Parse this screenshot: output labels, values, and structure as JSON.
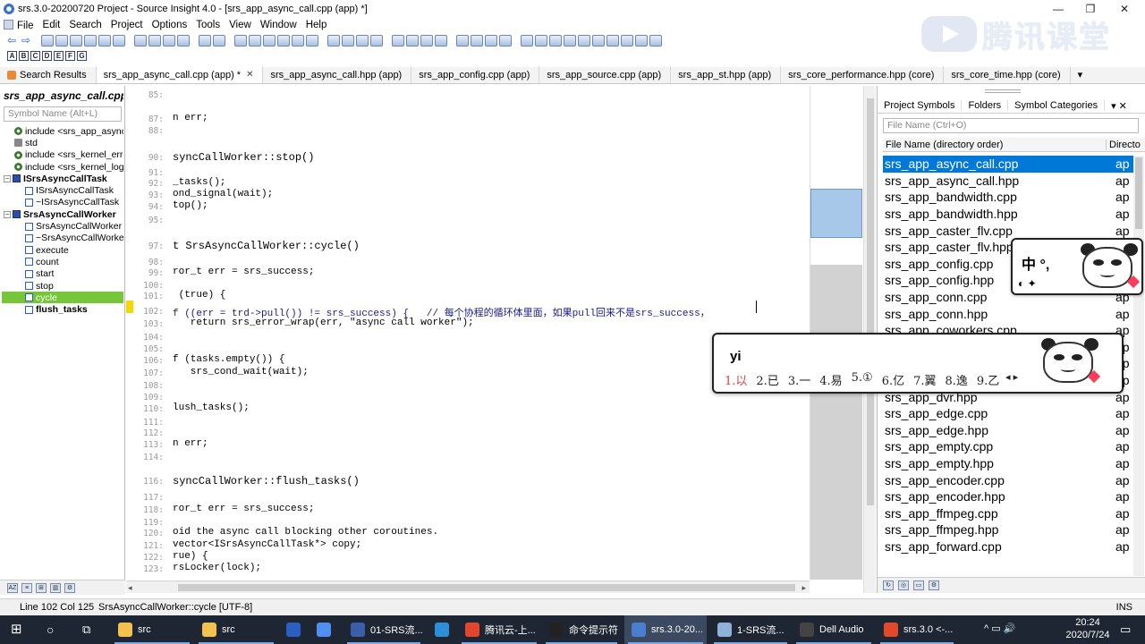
{
  "window": {
    "title": "srs.3.0-20200720 Project - Source Insight 4.0 - [srs_app_async_call.cpp (app) *]",
    "controls": {
      "minimize": "—",
      "restore": "❐",
      "close": "✕"
    }
  },
  "watermark": {
    "text": "腾讯课堂"
  },
  "menu": [
    "File",
    "Edit",
    "Search",
    "Project",
    "Options",
    "Tools",
    "View",
    "Window",
    "Help"
  ],
  "tabs": [
    {
      "label": "Search Results",
      "closable": false
    },
    {
      "label": "srs_app_async_call.cpp (app) *",
      "closable": true
    },
    {
      "label": "srs_app_async_call.hpp (app)",
      "closable": false
    },
    {
      "label": "srs_app_config.cpp (app)",
      "closable": false
    },
    {
      "label": "srs_app_source.cpp (app)",
      "closable": false
    },
    {
      "label": "srs_app_st.hpp (app)",
      "closable": false
    },
    {
      "label": "srs_core_performance.hpp (core)",
      "closable": false
    },
    {
      "label": "srs_core_time.hpp (core)",
      "closable": false
    }
  ],
  "tab_more": "▾",
  "symbol_panel": {
    "title": "srs_app_async_call.cpp",
    "search_placeholder": "Symbol Name (Alt+L)",
    "items": [
      {
        "label": "include <srs_app_async_call.hpp>",
        "kind": "gear",
        "indent": 1
      },
      {
        "label": "std",
        "kind": "ns",
        "indent": 1
      },
      {
        "label": "include <srs_kernel_error.hpp>",
        "kind": "gear",
        "indent": 1
      },
      {
        "label": "include <srs_kernel_log.hpp>",
        "kind": "gear",
        "indent": 1
      },
      {
        "label": "ISrsAsyncCallTask",
        "kind": "cls",
        "indent": 0,
        "bold": true
      },
      {
        "label": "ISrsAsyncCallTask",
        "kind": "fn",
        "indent": 2
      },
      {
        "label": "~ISrsAsyncCallTask",
        "kind": "fn",
        "indent": 2
      },
      {
        "label": "SrsAsyncCallWorker",
        "kind": "cls",
        "indent": 0,
        "bold": true
      },
      {
        "label": "SrsAsyncCallWorker",
        "kind": "fn",
        "indent": 2
      },
      {
        "label": "~SrsAsyncCallWorker",
        "kind": "fn",
        "indent": 2
      },
      {
        "label": "execute",
        "kind": "fn",
        "indent": 2
      },
      {
        "label": "count",
        "kind": "fn",
        "indent": 2
      },
      {
        "label": "start",
        "kind": "fn",
        "indent": 2
      },
      {
        "label": "stop",
        "kind": "fn",
        "indent": 2
      },
      {
        "label": "cycle",
        "kind": "fn",
        "indent": 2,
        "selected": true
      },
      {
        "label": "flush_tasks",
        "kind": "fn",
        "indent": 2,
        "bold": true
      }
    ]
  },
  "editor": {
    "lines": [
      {
        "n": "85:",
        "code": ""
      },
      {
        "n": "87:",
        "code": "n err;"
      },
      {
        "n": "88:",
        "code": ""
      },
      {
        "n": "90:",
        "code": "syncCallWorker::stop()"
      },
      {
        "n": "91:",
        "code": ""
      },
      {
        "n": "92:",
        "code": "_tasks();"
      },
      {
        "n": "93:",
        "code": "ond_signal(wait);"
      },
      {
        "n": "94:",
        "code": "top();"
      },
      {
        "n": "95:",
        "code": ""
      },
      {
        "n": "97:",
        "code": "t SrsAsyncCallWorker::cycle()"
      },
      {
        "n": "98:",
        "code": ""
      },
      {
        "n": "99:",
        "code": "ror_t err = srs_success;"
      },
      {
        "n": "100:",
        "code": ""
      },
      {
        "n": "101:",
        "code": " (true) {"
      },
      {
        "n": "102:",
        "code": "f ((err = trd->pull()) != srs_success) {   // 每个协程的循环体里面，如果pull回来不是srs_success，"
      },
      {
        "n": "103:",
        "code": "   return srs_error_wrap(err, \"async call worker\");"
      },
      {
        "n": "104:",
        "code": ""
      },
      {
        "n": "105:",
        "code": ""
      },
      {
        "n": "106:",
        "code": "f (tasks.empty()) {"
      },
      {
        "n": "107:",
        "code": "   srs_cond_wait(wait);"
      },
      {
        "n": "108:",
        "code": ""
      },
      {
        "n": "109:",
        "code": ""
      },
      {
        "n": "110:",
        "code": "lush_tasks();"
      },
      {
        "n": "111:",
        "code": ""
      },
      {
        "n": "112:",
        "code": ""
      },
      {
        "n": "113:",
        "code": "n err;"
      },
      {
        "n": "114:",
        "code": ""
      },
      {
        "n": "116:",
        "code": "syncCallWorker::flush_tasks()"
      },
      {
        "n": "117:",
        "code": ""
      },
      {
        "n": "118:",
        "code": "ror_t err = srs_success;"
      },
      {
        "n": "119:",
        "code": ""
      },
      {
        "n": "120:",
        "code": "oid the async call blocking other coroutines."
      },
      {
        "n": "121:",
        "code": "vector<ISrsAsyncCallTask*> copy;"
      },
      {
        "n": "122:",
        "code": "rue) {"
      },
      {
        "n": "123:",
        "code": "rsLocker(lock);"
      }
    ]
  },
  "right_panel": {
    "tabs": [
      "Project Symbols",
      "Folders",
      "Symbol Categories"
    ],
    "search_placeholder": "File Name (Ctrl+O)",
    "col_name": "File Name (directory order)",
    "col_dir": "Directo",
    "files": [
      {
        "name": "srs_app_async_call.cpp",
        "dir": "ap",
        "selected": true
      },
      {
        "name": "srs_app_async_call.hpp",
        "dir": "ap"
      },
      {
        "name": "srs_app_bandwidth.cpp",
        "dir": "ap"
      },
      {
        "name": "srs_app_bandwidth.hpp",
        "dir": "ap"
      },
      {
        "name": "srs_app_caster_flv.cpp",
        "dir": "ap"
      },
      {
        "name": "srs_app_caster_flv.hpp",
        "dir": "ap"
      },
      {
        "name": "srs_app_config.cpp",
        "dir": "ap"
      },
      {
        "name": "srs_app_config.hpp",
        "dir": "ap"
      },
      {
        "name": "srs_app_conn.cpp",
        "dir": "ap"
      },
      {
        "name": "srs_app_conn.hpp",
        "dir": "ap"
      },
      {
        "name": "srs_app_coworkers.cpp",
        "dir": "ap"
      },
      {
        "name": "srs_app_coworkers.hpp",
        "dir": "ap"
      },
      {
        "name": "srs_app_dvr.cpp",
        "dir": "ap"
      },
      {
        "name": "srs_app_dvr.cpp",
        "dir": "ap"
      },
      {
        "name": "srs_app_dvr.hpp",
        "dir": "ap"
      },
      {
        "name": "srs_app_edge.cpp",
        "dir": "ap"
      },
      {
        "name": "srs_app_edge.hpp",
        "dir": "ap"
      },
      {
        "name": "srs_app_empty.cpp",
        "dir": "ap"
      },
      {
        "name": "srs_app_empty.hpp",
        "dir": "ap"
      },
      {
        "name": "srs_app_encoder.cpp",
        "dir": "ap"
      },
      {
        "name": "srs_app_encoder.hpp",
        "dir": "ap"
      },
      {
        "name": "srs_app_ffmpeg.cpp",
        "dir": "ap"
      },
      {
        "name": "srs_app_ffmpeg.hpp",
        "dir": "ap"
      },
      {
        "name": "srs_app_forward.cpp",
        "dir": "ap"
      }
    ]
  },
  "ime": {
    "status_text": "中 °,",
    "pinyin": "yi",
    "candidates": [
      "1.以",
      "2.已",
      "3.一",
      "4.易",
      "5.①",
      "6.亿",
      "7.翼",
      "8.逸",
      "9.乙"
    ],
    "nav": "◂ ▸"
  },
  "status": {
    "position": "Line 102  Col 125",
    "context": "SrsAsyncCallWorker::cycle [UTF-8]",
    "mode": "INS"
  },
  "taskbar": {
    "items": [
      {
        "label": "",
        "icon_color": "#ffffff",
        "kind": "start"
      },
      {
        "label": "",
        "icon_color": "#ffffff",
        "kind": "search"
      },
      {
        "label": "",
        "icon_color": "#ffffff",
        "kind": "taskview"
      },
      {
        "label": "src",
        "icon_color": "#f2c14e"
      },
      {
        "label": "src",
        "icon_color": "#f2c14e"
      },
      {
        "label": "",
        "icon_color": "#2b5fc4"
      },
      {
        "label": "",
        "icon_color": "#4f8ff0"
      },
      {
        "label": "01-SRS流...",
        "icon_color": "#3a5fa8"
      },
      {
        "label": "",
        "icon_color": "#2c8fd8"
      },
      {
        "label": "腾讯云-上...",
        "icon_color": "#e2462f"
      },
      {
        "label": "命令提示符",
        "icon_color": "#222222"
      },
      {
        "label": "srs.3.0-20...",
        "icon_color": "#4a7fd0",
        "active": true
      },
      {
        "label": "1-SRS流...",
        "icon_color": "#8fb0d8"
      },
      {
        "label": "Dell Audio",
        "icon_color": "#444444"
      },
      {
        "label": "srs.3.0 <-...",
        "icon_color": "#e04a2a"
      }
    ],
    "tray": "^ ▭ 🔊",
    "time": "20:24",
    "date": "2020/7/24"
  }
}
